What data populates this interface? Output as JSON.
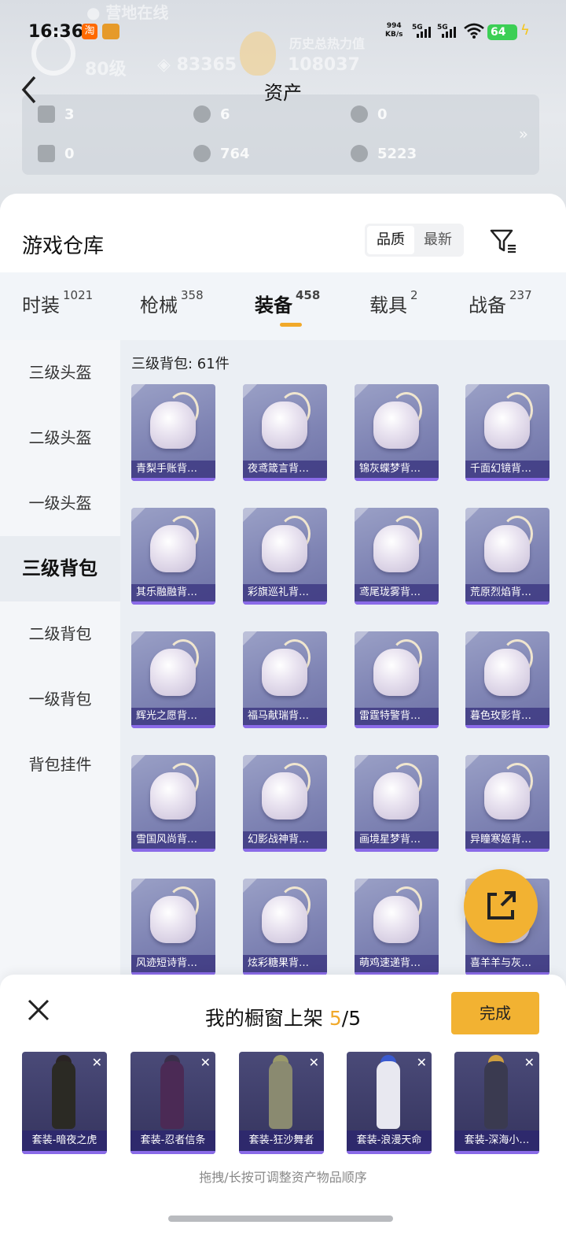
{
  "status_bar": {
    "time": "16:36",
    "app_icon_1": "淘",
    "net_speed_value": "994",
    "net_speed_unit": "KB/s",
    "sim1": "5G",
    "sim2": "5G",
    "battery": "64",
    "icons": [
      "wifi-icon",
      "charging-bolt-icon"
    ]
  },
  "background_profile": {
    "online_status": "● 营地在线",
    "level": "80级",
    "coins": "83365",
    "history_heat_label": "历史总热力值",
    "history_heat_value": "108037"
  },
  "header": {
    "back_icon": "back-chevron-icon",
    "title": "资产"
  },
  "stats": [
    {
      "icon": "card-icon",
      "value": "3"
    },
    {
      "icon": "silver-coin-icon",
      "value": "6"
    },
    {
      "icon": "gold-coin-icon",
      "value": "0"
    },
    {
      "icon": "green-card-icon",
      "value": "0"
    },
    {
      "icon": "gray-coin-icon",
      "value": "764"
    },
    {
      "icon": "bronze-coin-icon",
      "value": "5223"
    }
  ],
  "stats_more": "»",
  "warehouse": {
    "title": "游戏仓库",
    "sort_options": [
      "品质",
      "最新"
    ],
    "sort_active": "品质",
    "filter_icon": "filter-icon"
  },
  "category_tabs": [
    {
      "label": "时装",
      "count": "1021"
    },
    {
      "label": "枪械",
      "count": "358"
    },
    {
      "label": "装备",
      "count": "458",
      "active": true
    },
    {
      "label": "载具",
      "count": "2"
    },
    {
      "label": "战备",
      "count": "237"
    }
  ],
  "side_nav": [
    "三级头盔",
    "二级头盔",
    "一级头盔",
    "三级背包",
    "二级背包",
    "一级背包",
    "背包挂件"
  ],
  "side_nav_active": "三级背包",
  "grid": {
    "title": "三级背包: 61件",
    "items": [
      "青梨手账背…",
      "夜鸢箴言背…",
      "锦灰蝶梦背…",
      "千面幻镜背…",
      "其乐融融背…",
      "彩旗巡礼背…",
      "鸢尾珑雾背…",
      "荒原烈焰背…",
      "辉光之愿背…",
      "福马献瑞背…",
      "雷霆特警背…",
      "暮色玫影背…",
      "雪国风尚背…",
      "幻影战神背…",
      "画境星梦背…",
      "异瞳寒姬背…",
      "风迹短诗背…",
      "炫彩糖果背…",
      "萌鸡速递背…",
      "喜羊羊与灰…"
    ]
  },
  "share_icon": "share-external-icon",
  "showcase": {
    "close_icon": "close-icon",
    "title_prefix": "我的橱窗上架",
    "count_current": "5",
    "count_total": "/5",
    "done_label": "完成",
    "outfits": [
      "套装-暗夜之虎",
      "套装-忍者信条",
      "套装-狂沙舞者",
      "套装-浪漫天命",
      "套装-深海小…"
    ],
    "remove_icon": "✕",
    "hint": "拖拽/长按可调整资产物品顺序"
  },
  "colors": {
    "accent": "#f2b232",
    "tab_underline": "#f1a92a",
    "card_bg": "#8a8fbf",
    "card_caption": "#3e3a82"
  }
}
